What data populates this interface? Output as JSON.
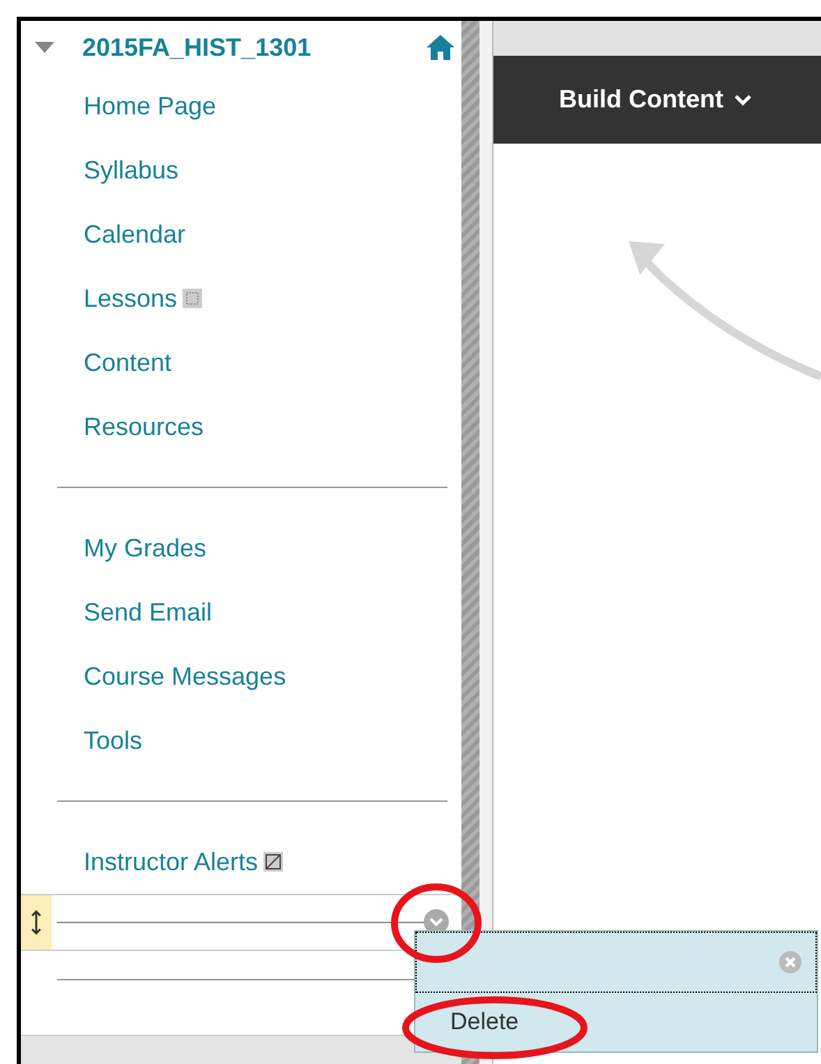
{
  "course": {
    "title": "2015FA_HIST_1301",
    "expanded": true
  },
  "menu": [
    {
      "kind": "link",
      "label": "Home Page"
    },
    {
      "kind": "link",
      "label": "Syllabus"
    },
    {
      "kind": "link",
      "label": "Calendar"
    },
    {
      "kind": "gridlink",
      "label": "Lessons"
    },
    {
      "kind": "link",
      "label": "Content"
    },
    {
      "kind": "link",
      "label": "Resources"
    },
    {
      "kind": "divider"
    },
    {
      "kind": "link",
      "label": "My Grades"
    },
    {
      "kind": "link",
      "label": "Send Email"
    },
    {
      "kind": "link",
      "label": "Course Messages"
    },
    {
      "kind": "link",
      "label": "Tools"
    },
    {
      "kind": "divider"
    },
    {
      "kind": "alertlink",
      "label": "Instructor Alerts"
    },
    {
      "kind": "dragrow"
    },
    {
      "kind": "divider"
    }
  ],
  "toolbar": {
    "button": "Build Content"
  },
  "context_menu": {
    "items": [
      "Delete"
    ]
  }
}
